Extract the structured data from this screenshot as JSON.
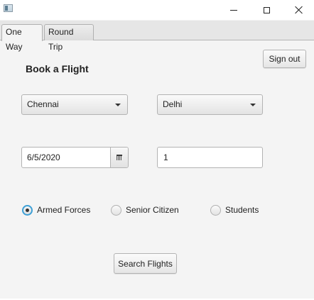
{
  "window": {
    "title": "",
    "controls": [
      "minimize",
      "maximize",
      "close"
    ]
  },
  "tabs": [
    {
      "label": "One Way",
      "active": true
    },
    {
      "label": "Round Trip",
      "active": false
    }
  ],
  "header": {
    "title": "Book a Flight",
    "signout_label": "Sign out"
  },
  "form": {
    "from": {
      "value": "Chennai"
    },
    "to": {
      "value": "Delhi"
    },
    "date": {
      "value": "6/5/2020"
    },
    "passengers": {
      "value": "1"
    },
    "categories": [
      {
        "label": "Armed Forces",
        "selected": true
      },
      {
        "label": "Senior Citizen",
        "selected": false
      },
      {
        "label": "Students",
        "selected": false
      }
    ],
    "search_label": "Search Flights"
  },
  "colors": {
    "accent": "#3ea0d6",
    "background": "#f4f4f4"
  },
  "icons": [
    "app-icon",
    "minimize-icon",
    "maximize-icon",
    "close-icon",
    "dropdown-arrow-icon",
    "calendar-icon"
  ]
}
